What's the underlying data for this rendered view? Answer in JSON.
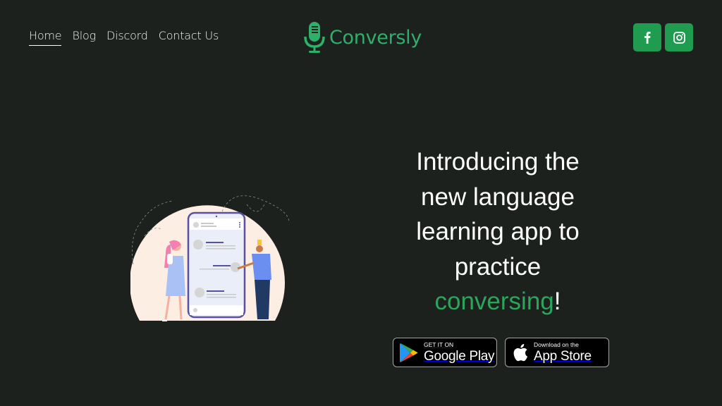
{
  "nav": {
    "items": [
      {
        "label": "Home",
        "active": true
      },
      {
        "label": "Blog"
      },
      {
        "label": "Discord"
      },
      {
        "label": "Contact Us"
      }
    ]
  },
  "logo": {
    "text": "Conversly",
    "icon": "microphone-icon",
    "color": "#2eb06a"
  },
  "social": [
    {
      "name": "facebook",
      "icon": "facebook-icon"
    },
    {
      "name": "instagram",
      "icon": "instagram-icon"
    }
  ],
  "hero": {
    "line1": "Introducing the",
    "line2": "new language",
    "line3": "learning app to",
    "line4": "practice",
    "accent": "conversing",
    "punct": "!"
  },
  "stores": {
    "google": {
      "small": "GET IT ON",
      "big": "Google Play"
    },
    "apple": {
      "small": "Download on the",
      "big": "App Store"
    }
  },
  "colors": {
    "background": "#1c211d",
    "accent": "#2da45b",
    "button": "#1f9c50"
  }
}
